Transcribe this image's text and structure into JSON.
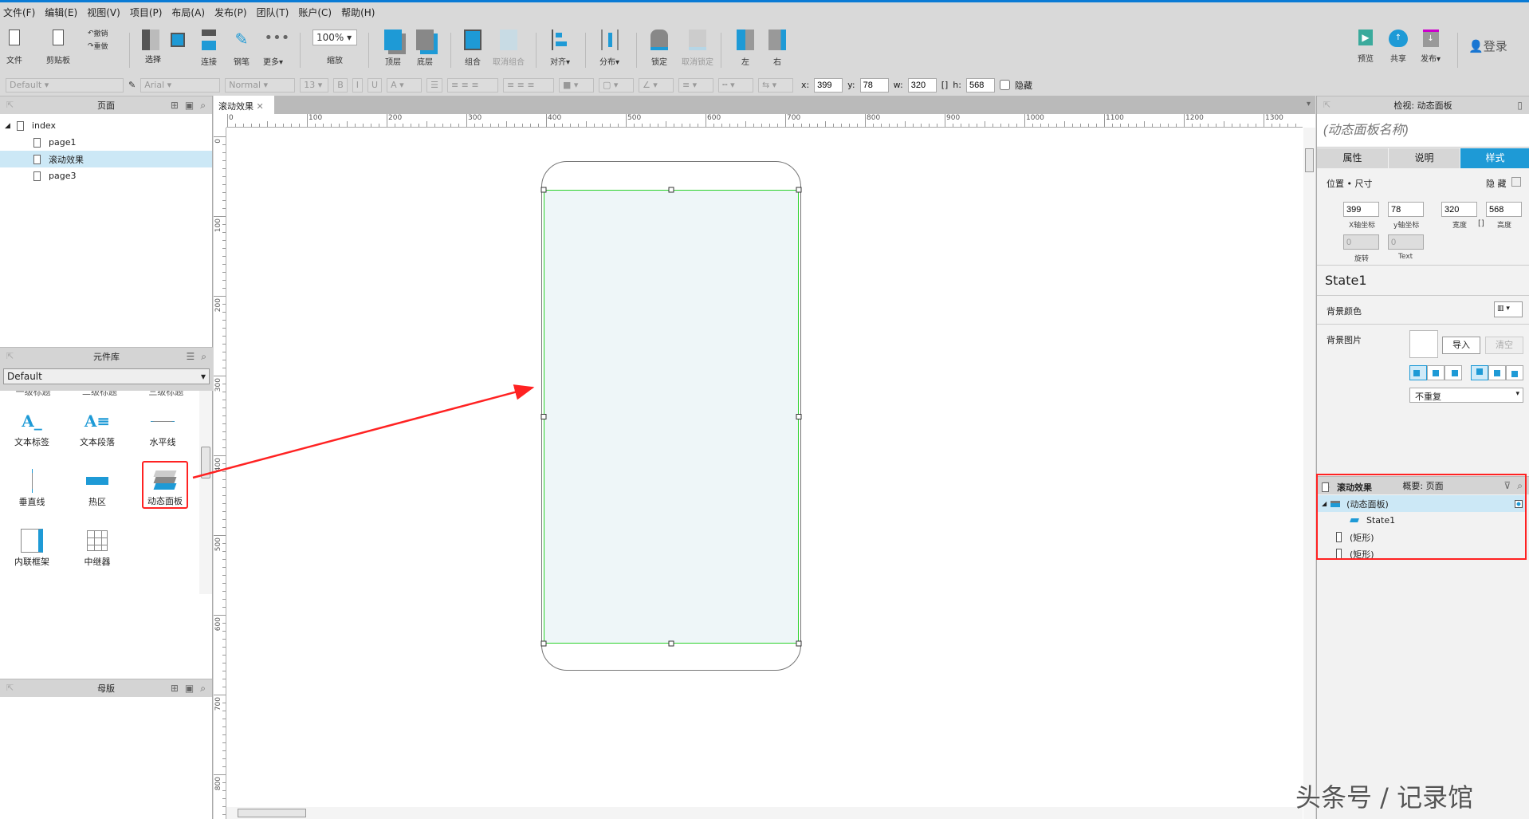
{
  "menu": [
    "文件(F)",
    "编辑(E)",
    "视图(V)",
    "项目(P)",
    "布局(A)",
    "发布(P)",
    "团队(T)",
    "账户(C)",
    "帮助(H)"
  ],
  "toolbar": {
    "file": "文件",
    "clipboard": "剪贴板",
    "undo": "撤销",
    "redo": "重做",
    "select": "选择",
    "connect": "连接",
    "pen": "钢笔",
    "more": "更多▾",
    "zoom_value": "100%",
    "zoom": "缩放",
    "top": "顶层",
    "bottom": "底层",
    "group": "组合",
    "ungroup": "取消组合",
    "align": "对齐▾",
    "distribute": "分布▾",
    "lock": "锁定",
    "unlock": "取消锁定",
    "left": "左",
    "right": "右",
    "preview": "预览",
    "share": "共享",
    "publish": "发布▾",
    "login": "登录"
  },
  "format": {
    "style": "Default",
    "font": "Arial",
    "weight": "Normal",
    "size": "13",
    "x_label": "x:",
    "x": "399",
    "y_label": "y:",
    "y": "78",
    "w_label": "w:",
    "w": "320",
    "h_label": "h:",
    "h": "568",
    "hide": "隐藏"
  },
  "pages": {
    "title": "页面",
    "items": [
      {
        "label": "index",
        "level": 0
      },
      {
        "label": "page1",
        "level": 1
      },
      {
        "label": "滚动效果",
        "level": 1,
        "selected": true
      },
      {
        "label": "page3",
        "level": 1
      }
    ]
  },
  "library": {
    "title": "元件库",
    "selected": "Default",
    "partial_row": [
      "一级标题",
      "二级标题",
      "三级标题"
    ],
    "items": [
      "文本标签",
      "文本段落",
      "水平线",
      "垂直线",
      "热区",
      "动态面板",
      "内联框架",
      "中继器"
    ]
  },
  "masters": {
    "title": "母版"
  },
  "canvas": {
    "tab": "滚动效果",
    "ruler_h": [
      "0",
      "100",
      "200",
      "300",
      "400",
      "500",
      "600",
      "700",
      "800",
      "900",
      "1000",
      "1100",
      "1200",
      "1300"
    ],
    "ruler_v": [
      "0",
      "100",
      "200",
      "300",
      "400",
      "500",
      "600",
      "700",
      "800"
    ]
  },
  "inspector": {
    "title": "检视: 动态面板",
    "name_placeholder": "(动态面板名称)",
    "tabs": [
      "属性",
      "说明",
      "样式"
    ],
    "active_tab": "样式",
    "pos_size": "位置 • 尺寸",
    "hide": "隐 藏",
    "x": "399",
    "y": "78",
    "w": "320",
    "h": "568",
    "x_label": "X轴坐标",
    "y_label": "y轴坐标",
    "w_label": "宽度",
    "h_label": "高度",
    "rotate": "0",
    "rotate_label": "旋转",
    "text_rotate": "0",
    "text_label": "Text",
    "state": "State1",
    "bg_color": "背景颜色",
    "bg_image": "背景图片",
    "import": "导入",
    "clear": "清空",
    "repeat": "不重复"
  },
  "outline": {
    "title": "概要: 页面",
    "items": [
      {
        "label": "滚动效果",
        "icon": "page-icon"
      },
      {
        "label": "(动态面板)",
        "icon": "dynamic-panel-icon",
        "selected": true
      },
      {
        "label": "State1",
        "icon": "state-icon"
      },
      {
        "label": "(矩形)",
        "icon": "rectangle-icon"
      },
      {
        "label": "(矩形)",
        "icon": "rectangle-icon"
      }
    ]
  },
  "watermark": "头条号 / 记录馆",
  "colors": {
    "accent": "#1e9ad6",
    "highlight": "#ff2020",
    "selection": "#cce8f6"
  }
}
